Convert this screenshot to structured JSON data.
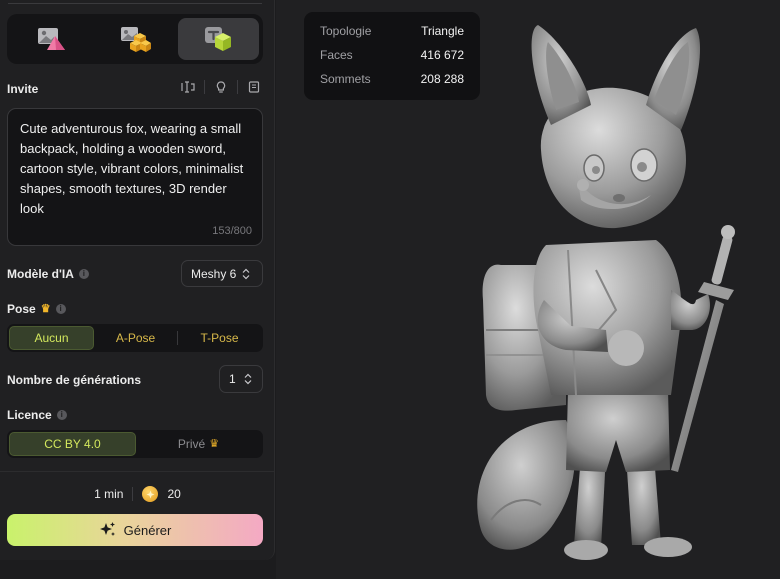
{
  "modes": [
    {
      "name": "image-to-3d",
      "active": false
    },
    {
      "name": "multi-image-to-3d",
      "active": false
    },
    {
      "name": "text-to-3d",
      "active": true
    }
  ],
  "invite": {
    "label": "Invite",
    "prompt": "Cute adventurous fox, wearing a small\nbackpack, holding a wooden sword,\ncartoon style, vibrant colors, minimalist\nshapes, smooth textures, 3D render\nlook",
    "count": "153/800"
  },
  "model": {
    "label": "Modèle d'IA",
    "value": "Meshy 6"
  },
  "pose": {
    "label": "Pose",
    "options": [
      "Aucun",
      "A-Pose",
      "T-Pose"
    ],
    "selected": "Aucun"
  },
  "generations": {
    "label": "Nombre de générations",
    "value": "1"
  },
  "licence": {
    "label": "Licence",
    "options": [
      "CC BY 4.0",
      "Privé"
    ],
    "selected": "CC BY 4.0"
  },
  "cost": {
    "time": "1 min",
    "credits": "20"
  },
  "generate": {
    "label": "Générer"
  },
  "stats": [
    {
      "key": "Topologie",
      "value": "Triangle"
    },
    {
      "key": "Faces",
      "value": "416 672"
    },
    {
      "key": "Sommets",
      "value": "208 288"
    }
  ],
  "colors": {
    "accent_green": "#d3e85d",
    "gold": "#f2b62a",
    "panel": "#202022",
    "field": "#141416"
  }
}
